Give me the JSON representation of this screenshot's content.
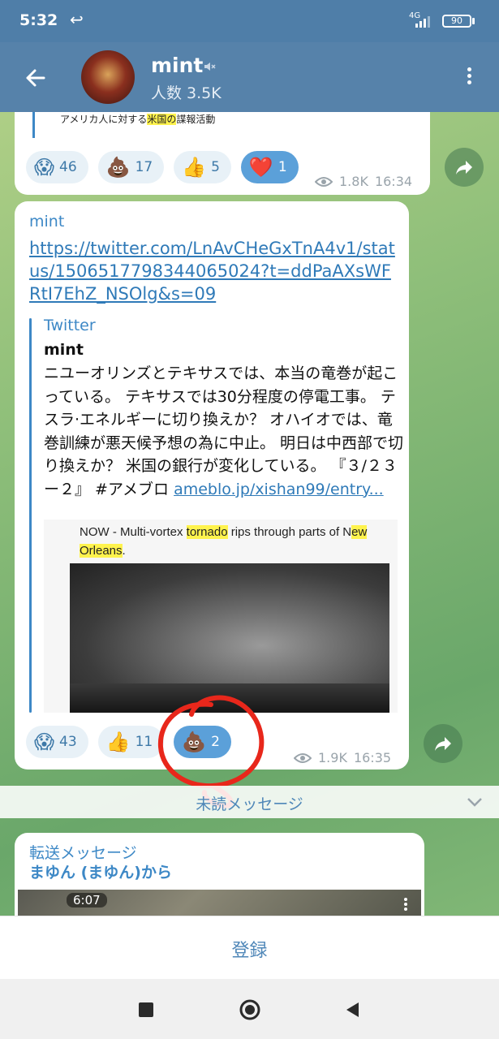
{
  "status_bar": {
    "time": "5:32",
    "network": "4G",
    "battery": "90"
  },
  "header": {
    "title": "mint",
    "members": "人数 3.5K"
  },
  "messages": [
    {
      "caption_prefix": "アメリカ人に対する",
      "caption_highlight": "米国の",
      "caption_suffix": "諜報活動",
      "reactions": [
        {
          "emoji": "😱",
          "count": "46"
        },
        {
          "emoji": "💩",
          "count": "17"
        },
        {
          "emoji": "👍",
          "count": "5"
        },
        {
          "emoji": "❤️",
          "count": "1"
        }
      ],
      "views": "1.8K",
      "time": "16:34"
    },
    {
      "sender": "mint",
      "link": "https://twitter.com/LnAvCHeGxTnA4v1/status/1506517798344065024?t=ddPaAXsWFRtI7EhZ_NSOlg&s=09",
      "preview": {
        "site": "Twitter",
        "title": "mint",
        "description": "ニユーオリンズとテキサスでは、本当の竜巻が起こっている。 テキサスでは30分程度の停電工事。 テスラ·エネルギーに切り換えか？ オハイオでは、竜巻訓練が悪天候予想の為に中止。 明日は中西部で切り換えか？ 米国の銀行が変化している。 『３/２３ー２』 #アメブロ ",
        "desc_link": "ameblo.jp/xishan99/entry...",
        "image_text": {
          "part1": "NOW - Multi-vortex ",
          "highlight1": "tornado",
          "part2": " rips through parts of N",
          "highlight2": "ew Orleans",
          "part3": "."
        }
      },
      "reactions": [
        {
          "emoji": "😱",
          "count": "43"
        },
        {
          "emoji": "👍",
          "count": "11"
        },
        {
          "emoji": "💩",
          "count": "2"
        }
      ],
      "views": "1.9K",
      "time": "16:35"
    }
  ],
  "unread_label": "未読メッセージ",
  "forwarded": {
    "label": "転送メッセージ",
    "from": "まゆん (まゆん)から",
    "video_duration": "6:07"
  },
  "join_button": "登録"
}
